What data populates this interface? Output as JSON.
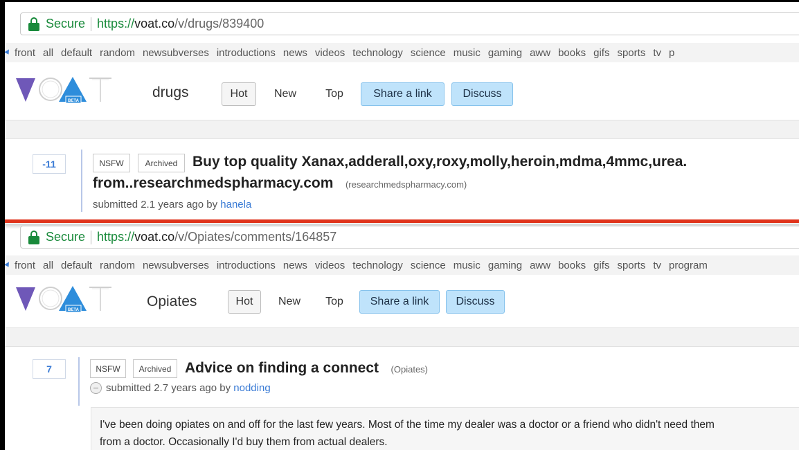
{
  "colors": {
    "secure_green": "#198a3b",
    "accent_blue": "#3a7bd5",
    "button_blue": "#bfe3fb",
    "divider_red": "#e0341c",
    "logo_purple": "#6f58b8",
    "logo_blue": "#2e8ddb"
  },
  "logo": {
    "letters": [
      "V",
      "O",
      "A",
      "T"
    ],
    "badge": "BETA"
  },
  "top": {
    "address": {
      "secure": "Secure",
      "scheme": "https://",
      "host": "voat.co",
      "path": "/v/drugs/839400"
    },
    "nav": [
      "front",
      "all",
      "default",
      "random",
      "newsubverses",
      "introductions",
      "news",
      "videos",
      "technology",
      "science",
      "music",
      "gaming",
      "aww",
      "books",
      "gifs",
      "sports",
      "tv",
      "p"
    ],
    "subverse": "drugs",
    "buttons": {
      "hot": "Hot",
      "new": "New",
      "top": "Top",
      "share": "Share a link",
      "discuss": "Discuss"
    },
    "post": {
      "score": "-11",
      "tag_nsfw": "NSFW",
      "tag_archived": "Archived",
      "title_line1": "Buy top quality Xanax,adderall,oxy,roxy,molly,heroin,mdma,4mmc,urea.",
      "title_line2": "from..researchmedspharmacy.com",
      "domain": "(researchmedspharmacy.com)",
      "submitted": "submitted 2.1 years ago by",
      "author": "hanela"
    }
  },
  "bottom": {
    "address": {
      "secure": "Secure",
      "scheme": "https://",
      "host": "voat.co",
      "path": "/v/Opiates/comments/164857"
    },
    "nav": [
      "front",
      "all",
      "default",
      "random",
      "newsubverses",
      "introductions",
      "news",
      "videos",
      "technology",
      "science",
      "music",
      "gaming",
      "aww",
      "books",
      "gifs",
      "sports",
      "tv",
      "program"
    ],
    "subverse": "Opiates",
    "buttons": {
      "hot": "Hot",
      "new": "New",
      "top": "Top",
      "share": "Share a link",
      "discuss": "Discuss"
    },
    "post": {
      "score": "7",
      "tag_nsfw": "NSFW",
      "tag_archived": "Archived",
      "title": "Advice on finding a connect",
      "domain": "(Opiates)",
      "submitted": "submitted 2.7 years ago by",
      "author": "nodding",
      "body_line1": "I've been doing opiates on and off for the last few years. Most of the time my dealer was a doctor or a friend who didn't need them",
      "body_line2": "from a doctor. Occasionally I'd buy them from actual dealers."
    }
  }
}
